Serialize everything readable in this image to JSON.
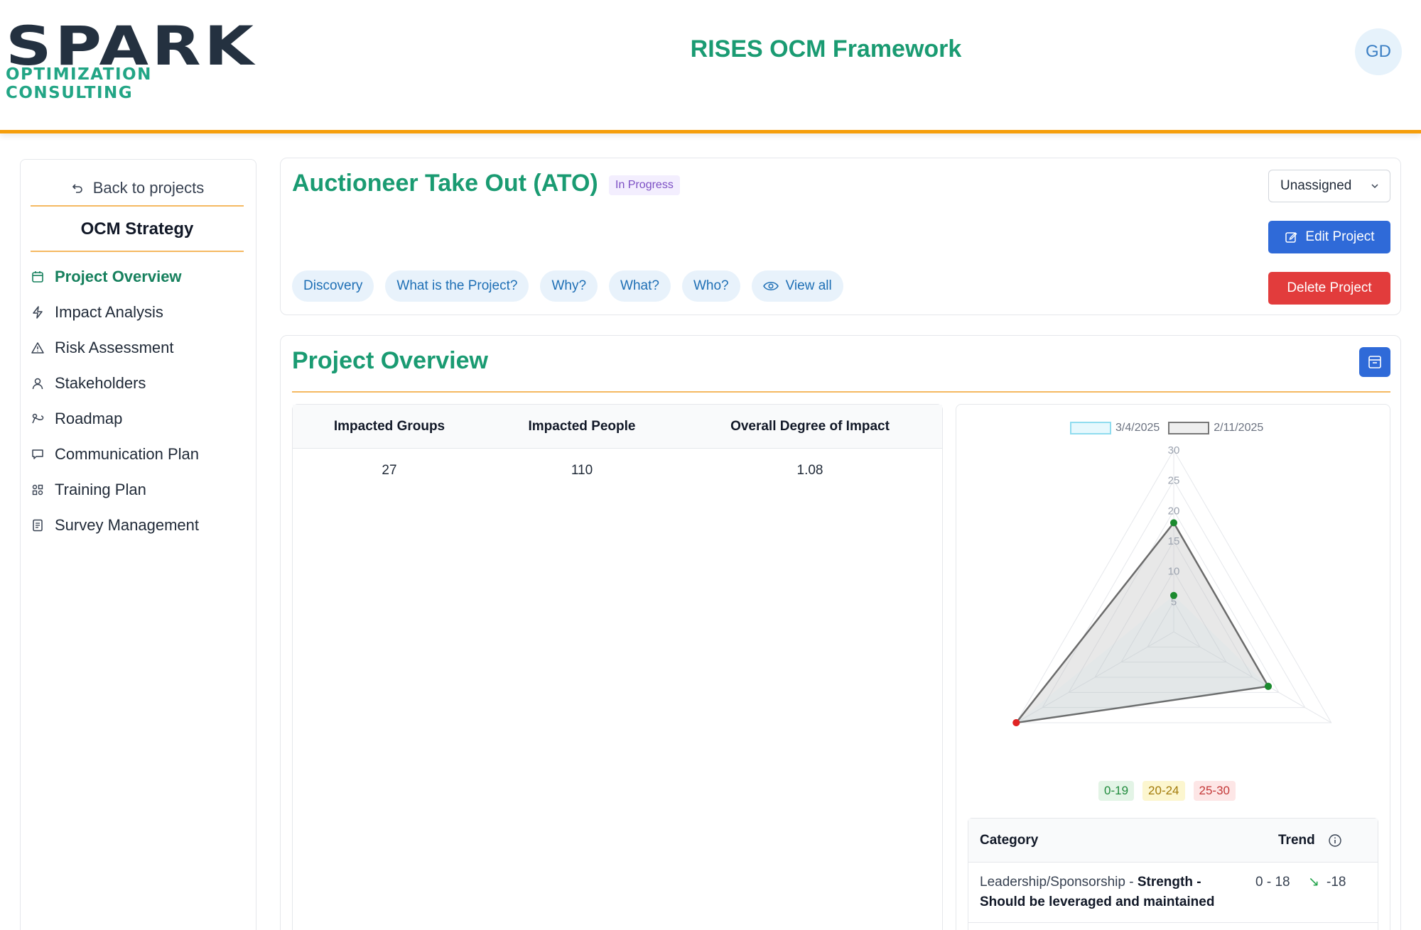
{
  "brand": {
    "logo_main": "SPARK",
    "logo_sub": "OPTIMIZATION CONSULTING",
    "accent": "#f59e0b",
    "primary": "#1a9b72"
  },
  "app": {
    "title": "RISES OCM Framework",
    "avatar_initials": "GD"
  },
  "sidebar": {
    "back_label": "Back to projects",
    "title": "OCM Strategy",
    "items": [
      {
        "label": "Project Overview",
        "icon": "calendar-icon",
        "active": true
      },
      {
        "label": "Impact Analysis",
        "icon": "bolt-icon"
      },
      {
        "label": "Risk Assessment",
        "icon": "warning-icon"
      },
      {
        "label": "Stakeholders",
        "icon": "user-icon"
      },
      {
        "label": "Roadmap",
        "icon": "map-icon"
      },
      {
        "label": "Communication Plan",
        "icon": "message-icon"
      },
      {
        "label": "Training Plan",
        "icon": "grid-icon"
      },
      {
        "label": "Survey Management",
        "icon": "document-icon"
      }
    ]
  },
  "project": {
    "title": "Auctioneer Take Out (ATO)",
    "status": "In Progress",
    "assignee": "Unassigned",
    "edit_label": "Edit Project",
    "delete_label": "Delete Project",
    "chips": [
      "Discovery",
      "What is the Project?",
      "Why?",
      "What?",
      "Who?"
    ],
    "view_all_label": "View all"
  },
  "overview": {
    "title": "Project Overview",
    "table": {
      "headers": [
        "Impacted Groups",
        "Impacted People",
        "Overall Degree of Impact"
      ],
      "values": [
        "27",
        "110",
        "1.08"
      ]
    }
  },
  "chart_data": {
    "type": "radar",
    "legend": [
      {
        "name": "3/4/2025",
        "color": "#8fdcef"
      },
      {
        "name": "2/11/2025",
        "color": "#d9d9d9"
      }
    ],
    "r_ticks": [
      "5",
      "10",
      "15",
      "20",
      "25",
      "30"
    ],
    "rmax": 30,
    "axes": 3,
    "series": [
      {
        "name": "3/4/2025",
        "values": [
          6,
          18,
          30
        ],
        "point_colors": [
          "#1b8a2e",
          "#1b8a2e",
          "#e02424"
        ]
      },
      {
        "name": "2/11/2025",
        "values": [
          18,
          18,
          30
        ]
      }
    ]
  },
  "ranges": [
    "0-19",
    "20-24",
    "25-30"
  ],
  "category_table": {
    "headers": {
      "category": "Category",
      "trend": "Trend"
    },
    "rows": [
      {
        "category": "Leadership/Sponsorship",
        "sep": " - ",
        "assessment": "Strength - Should be leveraged and maintained",
        "range": "0 - 18",
        "trend_arrow": "↘",
        "trend": "-18"
      }
    ]
  }
}
